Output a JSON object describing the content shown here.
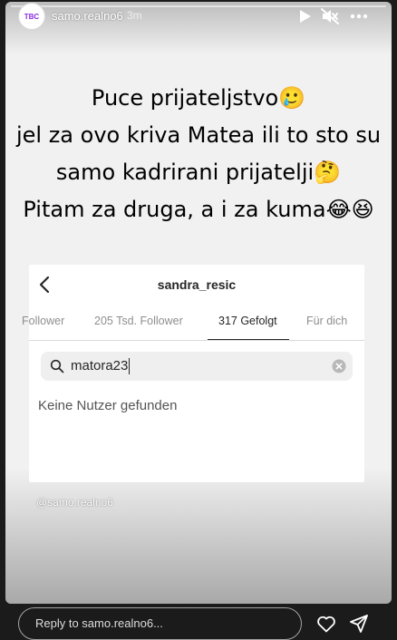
{
  "story": {
    "username": "samo.realno6",
    "time": "3m",
    "progress": 0,
    "avatar_text": "TBC",
    "lines": [
      "Puce prijateljstvo🥲",
      "jel za ovo kriva Matea ili to sto su",
      "samo kadrirani prijatelji🤔",
      "Pitam za druga, a i za kuma😂😆"
    ]
  },
  "icons": {
    "play": "play-icon",
    "mute": "mute-icon",
    "more": "more-icon",
    "heart": "heart-icon",
    "send": "send-icon"
  },
  "screenshot": {
    "title": "sandra_resic",
    "tabs": [
      {
        "label": "Follower",
        "active": false
      },
      {
        "label": "205 Tsd. Follower",
        "active": false
      },
      {
        "label": "317 Gefolgt",
        "active": true
      },
      {
        "label": "Für dich",
        "active": false
      }
    ],
    "search_value": "matora23",
    "no_results": "Keine Nutzer gefunden"
  },
  "watermark": "@samo.realno6",
  "reply": {
    "placeholder": "Reply to samo.realno6..."
  }
}
